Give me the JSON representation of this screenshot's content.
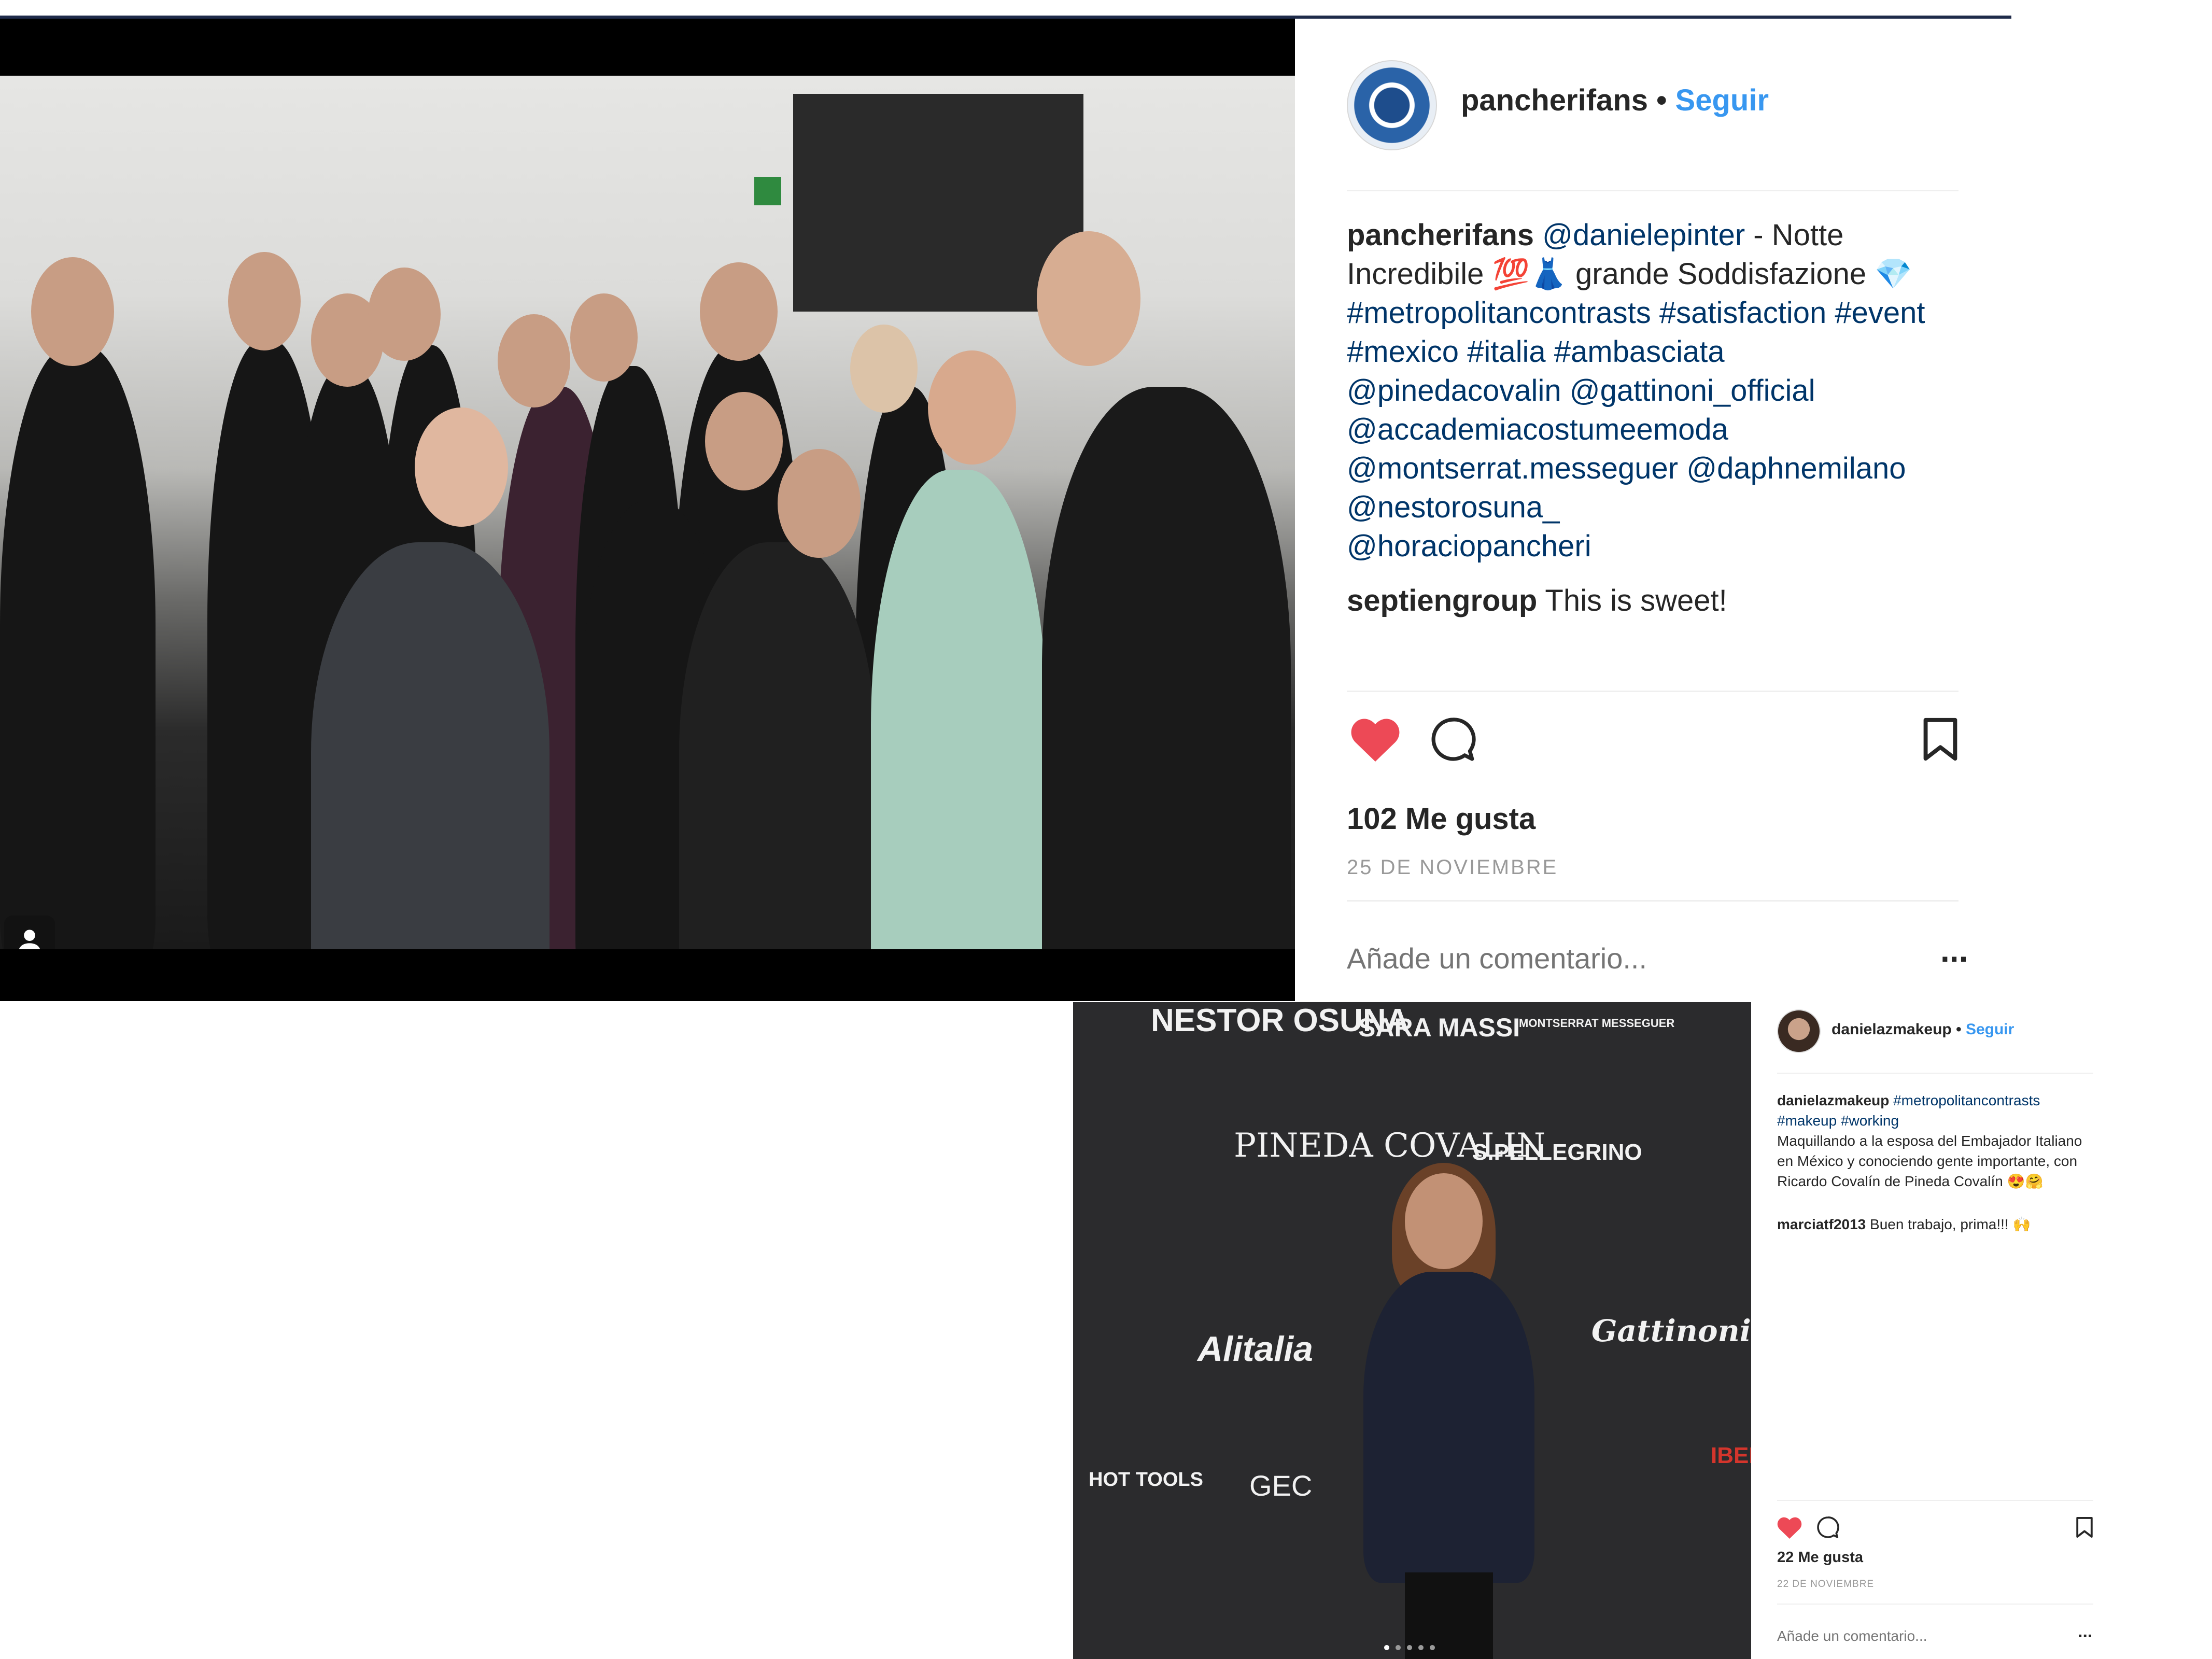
{
  "colors": {
    "link_blue": "#3897f0",
    "mention_blue": "#003569",
    "heart_red": "#ed4956",
    "text": "#262626",
    "muted": "#999999",
    "divider": "#efefef"
  },
  "post1": {
    "username": "pancherifans",
    "separator": " • ",
    "follow_label": "Seguir",
    "caption": {
      "username": "pancherifans",
      "parts": [
        "@danielepinter",
        " - Notte Incredibile 💯👗 grande Soddisfazione 💎",
        "#metropolitancontrasts",
        "#satisfaction",
        "#event",
        "#mexico",
        "#italia",
        "#ambasciata",
        "@pinedacovalin",
        "@gattinoni_official",
        "@accademiacostumeemoda",
        "@montserrat.messeguer",
        "@daphnemilano",
        "@nestorosuna_",
        "@horaciopancheri"
      ]
    },
    "comment": {
      "username": "septiengroup",
      "text": "This is sweet!"
    },
    "icons": {
      "like": "heart-icon",
      "comment": "comment-icon",
      "save": "bookmark-icon",
      "tag": "user-tag-icon"
    },
    "likes_text": "102 Me gusta",
    "date_text": "25 DE NOVIEMBRE",
    "comment_placeholder": "Añade un comentario...",
    "more_label": "..."
  },
  "post2": {
    "username": "danielazmakeup",
    "separator": " • ",
    "follow_label": "Seguir",
    "caption": {
      "username": "danielazmakeup",
      "tags": [
        "#metropolitancontrasts",
        "#makeup",
        "#working"
      ],
      "text": "Maquillando a la esposa del Embajador Italiano en México y conociendo gente importante, con Ricardo Covalín de Pineda Covalín 😍🤗"
    },
    "comment": {
      "username": "marciatf2013",
      "text": "Buen trabajo, prima!!! 🙌"
    },
    "wall_logos": [
      "NESTOR OSUNA",
      "SARA MASSI",
      "MONTSERRAT MESSEGUER",
      "PINEDA COVALIN",
      "S.PELLEGRINO",
      "Alitalia",
      "Gattinoni",
      "HOT TOOLS",
      "GEC",
      "IBER"
    ],
    "icons": {
      "like": "heart-icon",
      "comment": "comment-icon",
      "save": "bookmark-icon"
    },
    "likes_text": "22 Me gusta",
    "date_text": "22 DE NOVIEMBRE",
    "comment_placeholder": "Añade un comentario...",
    "more_label": "..."
  }
}
